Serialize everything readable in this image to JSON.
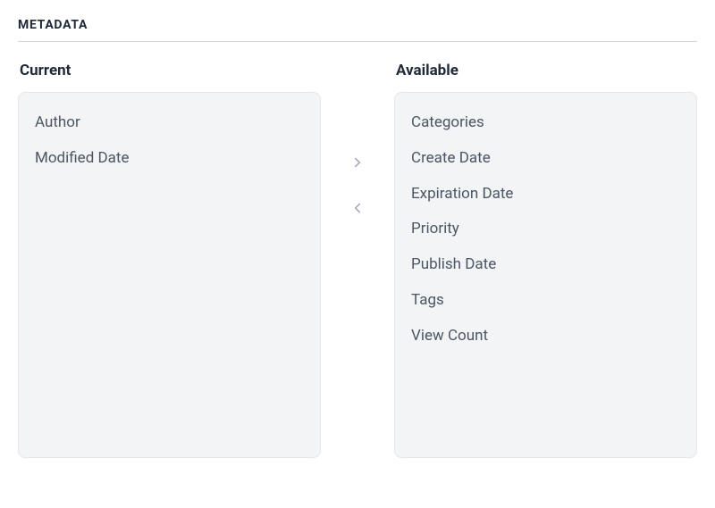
{
  "section_title": "METADATA",
  "current": {
    "label": "Current",
    "items": [
      "Author",
      "Modified Date"
    ]
  },
  "available": {
    "label": "Available",
    "items": [
      "Categories",
      "Create Date",
      "Expiration Date",
      "Priority",
      "Publish Date",
      "Tags",
      "View Count"
    ]
  }
}
